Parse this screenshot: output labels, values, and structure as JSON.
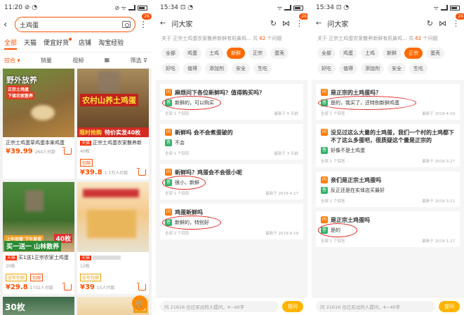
{
  "phone1": {
    "status_time": "11:20",
    "status_icons": "⊘ ◔",
    "status_right": "⊘ ᯤ",
    "search_query": "土鸡蛋",
    "badge_count": "26",
    "tabs": [
      "全部",
      "天猫",
      "便宜好货",
      "店铺",
      "淘宝经验"
    ],
    "sort": [
      "综合 ▾",
      "销量",
      "视频",
      "筛选"
    ],
    "products": [
      {
        "overlay_big": "野外放养",
        "overlay_tag": "正宗土鸡蛋",
        "overlay_tag2": "下蛋农家散养",
        "title": "正宗土鸡蛋草鸡蛋本笨鸡蛋",
        "price": "¥39.",
        "price_sub": "99",
        "sold": "264人付款"
      },
      {
        "overlay_banner": "农村山养土鸡蛋",
        "stripe_a": "限时抢购",
        "stripe_b": "特价实发40枚",
        "tag": "天猫",
        "title": "正宗土鸡蛋农家散养新",
        "sub": "40枚",
        "chip": "包邮",
        "price": "¥39.",
        "price_sub": "8",
        "sold": "1.7万人付款"
      },
      {
        "overlay_tl": "上午捡蛋 下午发货",
        "overlay_40": "40枚",
        "overlay_mid": "买一送一 山林散养",
        "tag": "天猫",
        "title": "买1送1正宗农家土鸡蛋",
        "sub": "20枚",
        "chip": "全年包邮",
        "chip2": "包邮",
        "price": "¥29.",
        "price_sub": "8",
        "sold": "1732人付款"
      },
      {
        "tag": "天猫",
        "title": "",
        "sub": "12枚",
        "chip": "全年包邮",
        "price": "¥39",
        "price_sub": "",
        "sold": "15人付款"
      },
      {
        "overlay_30": "30枚"
      },
      {
        "overlay_ns": "领券"
      }
    ],
    "cart_fab": "🛒"
  },
  "phone2": {
    "status_time": "15:34",
    "status_icons": "⊡ ◔",
    "status_right": "ᯤ",
    "title": "问大家",
    "badge_count": "26",
    "intro_a": "关于 正宗土鸡蛋农家散养新鲜有机柴鸡... 共",
    "intro_count": "62",
    "intro_b": "个问题",
    "filters": [
      "全部",
      "鸡蛋",
      "土鸡",
      "新鲜",
      "正宗",
      "蛋壳",
      "好吃",
      "值得",
      "添加剂",
      "安全",
      "生吃"
    ],
    "active_filter": 3,
    "qa": [
      {
        "q": "麻烦问下各位新鲜吗？值得购买吗？",
        "a": "新鲜的，可以购买",
        "count": "全部 1 个回答",
        "date": "最新于 5 天前"
      },
      {
        "q": "新鲜吗 会不会煮蛋破的",
        "a": "不会",
        "count": "全部 1 个回答",
        "date": "最新于 3 天前"
      },
      {
        "q": "新鲜吗？鸡蛋会不会很小呢",
        "a": "很小，新鲜",
        "count": "全部 1 个回答",
        "date": "最新于 2019-4-17"
      },
      {
        "q": "鸡蛋新鲜吗",
        "a": "新鲜的，特别好",
        "count": "全部 2 个回答",
        "date": "最新于 2019-4-19"
      }
    ],
    "ask_placeholder": "问 21616 位已买过的人提问，4~40字",
    "ask_button": "提问"
  },
  "phone3": {
    "status_time": "15:34",
    "status_icons": "⊡ ◔",
    "status_right": "ᯤ",
    "title": "问大家",
    "badge_count": "26",
    "intro_a": "关于 正宗土鸡蛋农家散养新鲜有机柴鸡... 共",
    "intro_count": "62",
    "intro_b": "个问题",
    "filters": [
      "全部",
      "鸡蛋",
      "土鸡",
      "新鲜",
      "正宗",
      "蛋壳",
      "好吃",
      "值得",
      "添加剂",
      "安全",
      "生吃"
    ],
    "active_filter": 4,
    "qa": [
      {
        "q": "是正宗的土鸡蛋吗？",
        "a": "是的，我买了，还特别新鲜鸡蛋",
        "count": "全部 1 个回答",
        "date": "最新于 2019-4-10"
      },
      {
        "q": "没见过这么大量的土鸡蛋，我们一个村的土鸡都下不了这么多蛋吧，很质疑这个量是正宗的",
        "a": "好像不是土鸡蛋",
        "count": "全部 1 个回答",
        "date": "最新于 2019-3-27"
      },
      {
        "q": "亲们是正宗土鸡蛋吗",
        "a": "反正还是在实体店买最好",
        "count": "全部 1 个回答",
        "date": "最新于 2019-3-11"
      },
      {
        "q": "是正宗土鸡蛋吗",
        "a": "是的",
        "count": "全部 1 个回答",
        "date": "最新于 2019-1-27"
      }
    ],
    "ask_placeholder": "问 21616 位已买过的人提问，4~40字",
    "ask_button": "提问"
  },
  "colors": {
    "accent": "#ff5000",
    "highlight_circle": "#e2231a",
    "answer_icon": "#34b26a",
    "question_icon": "#ff7b00"
  }
}
